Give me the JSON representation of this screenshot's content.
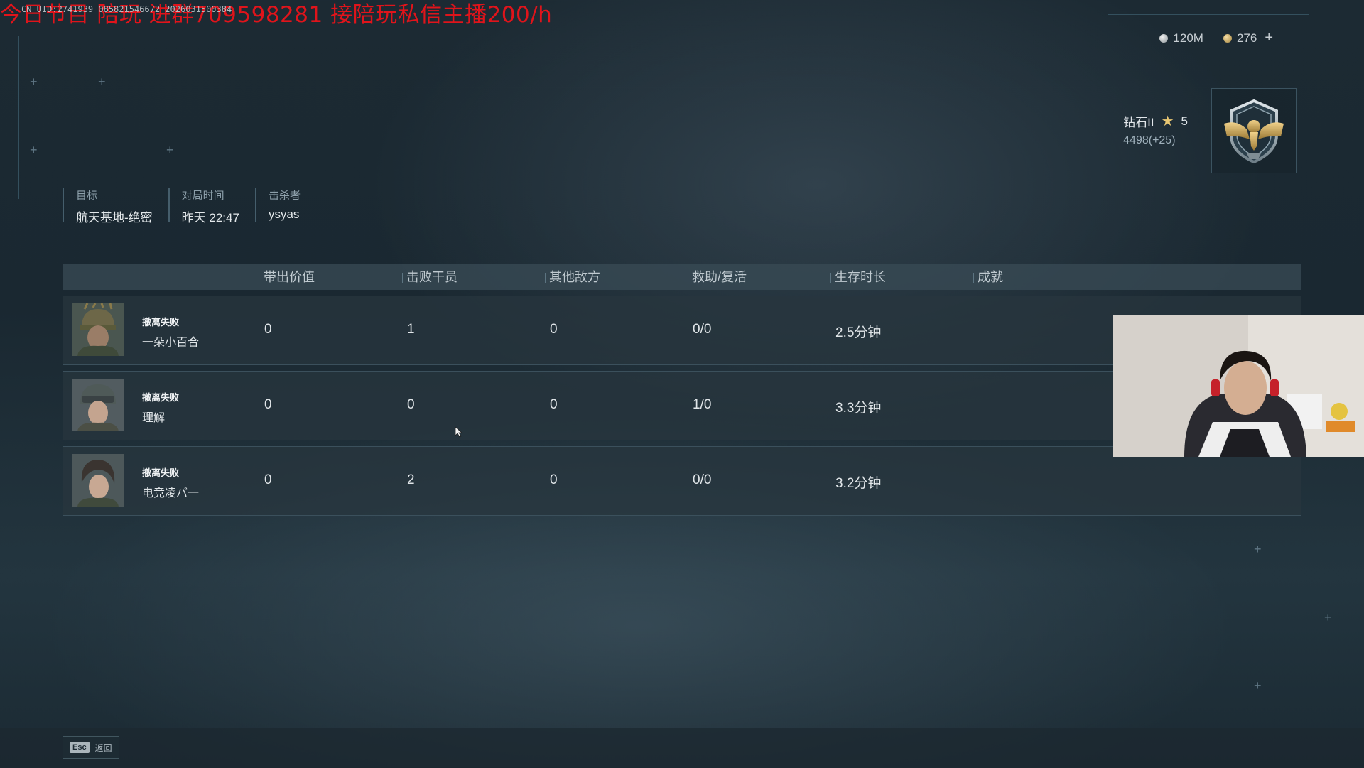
{
  "overlay": {
    "promo_text": "今日节目 陪玩 进群709598281 接陪玩私信主播200/h",
    "uid_text": "CN UID:2741939 085821546672 2026031500384"
  },
  "currency": {
    "silver_amount": "120M",
    "gold_amount": "276",
    "add_symbol": "+"
  },
  "rank": {
    "tier": "钻石II",
    "stars": "5",
    "points": "4498(+25)"
  },
  "match_info": [
    {
      "label": "目标",
      "value": "航天基地-绝密"
    },
    {
      "label": "对局时间",
      "value": "昨天 22:47"
    },
    {
      "label": "击杀者",
      "value": "ysyas"
    }
  ],
  "table": {
    "columns": [
      "带出价值",
      "击败干员",
      "其他敌方",
      "救助/复活",
      "生存时长",
      "成就"
    ],
    "rows": [
      {
        "status": "撤离失败",
        "name": "一朵小百合",
        "extract_value": "0",
        "operators_defeated": "1",
        "other_enemies": "0",
        "assist_revive": "0/0",
        "survival_time": "2.5分钟",
        "achievement": ""
      },
      {
        "status": "撤离失败",
        "name": "理解",
        "extract_value": "0",
        "operators_defeated": "0",
        "other_enemies": "0",
        "assist_revive": "1/0",
        "survival_time": "3.3分钟",
        "achievement": ""
      },
      {
        "status": "撤离失败",
        "name": "电竞凌バ一",
        "extract_value": "0",
        "operators_defeated": "2",
        "other_enemies": "0",
        "assist_revive": "0/0",
        "survival_time": "3.2分钟",
        "achievement": ""
      }
    ]
  },
  "footer": {
    "esc_key": "Esc",
    "back_label": "返回"
  },
  "colors": {
    "accent_red": "#e0141b",
    "star_gold": "#e8c773"
  }
}
